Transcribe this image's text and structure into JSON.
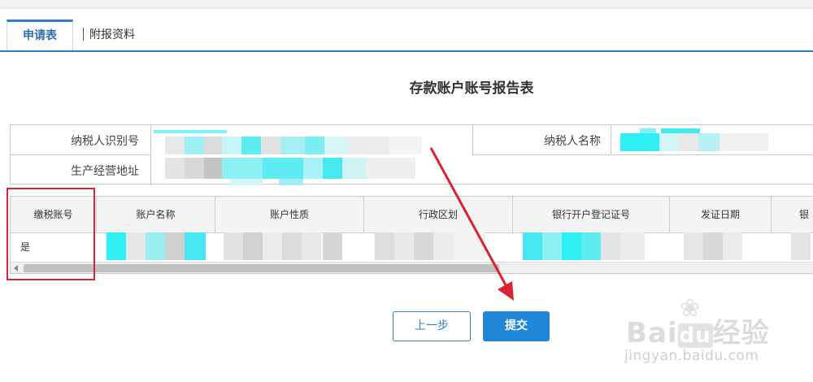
{
  "tabs": [
    {
      "label": "申请表",
      "active": true
    },
    {
      "label": "附报资料",
      "active": false
    }
  ],
  "form": {
    "title": "存款账户账号报告表",
    "taxpayer_id_label": "纳税人识别号",
    "taxpayer_name_label": "纳税人名称",
    "address_label": "生产经营地址"
  },
  "grid": {
    "columns": [
      "缴税账号",
      "账户名称",
      "账户性质",
      "行政区划",
      "银行开户登记证号",
      "发证日期",
      "银"
    ],
    "rows": [
      {
        "tax_account": "是"
      }
    ]
  },
  "buttons": {
    "prev": "上一步",
    "submit": "提交"
  },
  "watermark": {
    "logo_b": "Bai",
    "logo_du": "du",
    "logo_cn": "经验",
    "url": "jingyan.baidu.com"
  },
  "colors": {
    "accent": "#2f7fc8",
    "submit": "#1f86d8",
    "highlight": "#d9232e",
    "redacted_cyan": "#48e8f0",
    "redacted_gray": "#cfcfcf"
  }
}
